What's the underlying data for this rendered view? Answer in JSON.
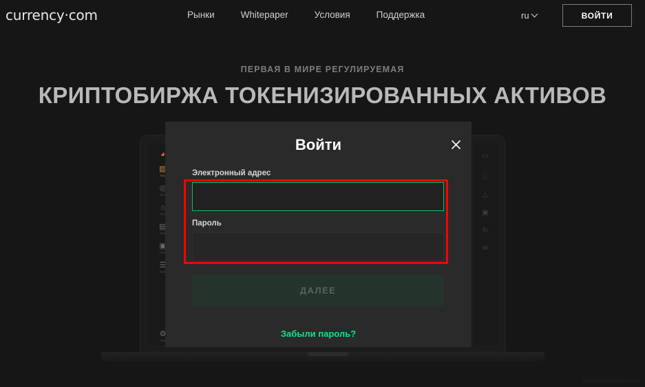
{
  "header": {
    "logo": "currency·com",
    "nav": [
      {
        "label": "Рынки"
      },
      {
        "label": "Whitepaper"
      },
      {
        "label": "Условия"
      },
      {
        "label": "Поддержка"
      }
    ],
    "language": "ru",
    "language_icon": "chevron-down-icon",
    "login_button": "ВОЙТИ"
  },
  "hero": {
    "subtitle": "ПЕРВАЯ В МИРЕ РЕГУЛИРУЕМАЯ",
    "title": "КРИПТОБИРЖА ТОКЕНИЗИРОВАННЫХ АКТИВОВ"
  },
  "mockup": {
    "left_sidebar": [
      {
        "icon": "brand-logo-icon",
        "label": ""
      },
      {
        "icon": "chart-icon",
        "label": "Trad"
      },
      {
        "icon": "compass-icon",
        "label": "Disc"
      },
      {
        "icon": "bank-icon",
        "label": "Char"
      },
      {
        "icon": "briefcase-icon",
        "label": "Port"
      },
      {
        "icon": "wallet-icon",
        "label": "Pers"
      },
      {
        "icon": "list-icon",
        "label": "Orde"
      }
    ],
    "left_sidebar_bottom": [
      {
        "icon": "settings-icon",
        "label": "Sett"
      }
    ],
    "right_sidebar": [
      {
        "icon": "minimize-icon"
      },
      {
        "icon": "info-icon"
      },
      {
        "icon": "bell-icon"
      },
      {
        "icon": "monitor-icon"
      },
      {
        "icon": "refresh-icon"
      },
      {
        "icon": "mail-icon"
      }
    ]
  },
  "modal": {
    "title": "Войти",
    "close_icon": "close-icon",
    "email_label": "Электронный адрес",
    "email_value": "",
    "email_placeholder": "",
    "password_label": "Пароль",
    "password_value": "",
    "password_placeholder": "",
    "submit_label": "ДАЛЕЕ",
    "forgot_label": "Забыли пароль?"
  },
  "annotation": {
    "color": "#ff0000"
  },
  "watermark": "profinvestment.com",
  "colors": {
    "page_background": "#161616",
    "modal_background": "#2a2a2a",
    "accent_green": "#14e08a",
    "input_focus_border": "#15b86b",
    "submit_disabled_bg": "#24332c",
    "annotation_red": "#ff0000"
  }
}
